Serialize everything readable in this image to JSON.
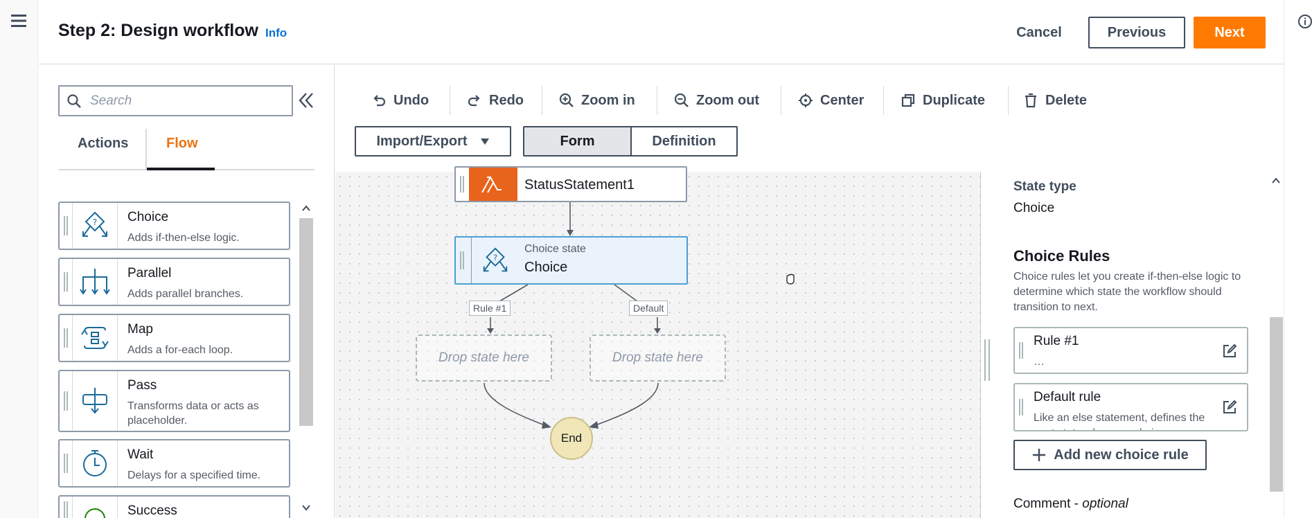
{
  "header": {
    "title": "Step 2: Design workflow",
    "info_link": "Info",
    "cancel_label": "Cancel",
    "previous_label": "Previous",
    "next_label": "Next"
  },
  "palette": {
    "search_placeholder": "Search",
    "tabs": [
      {
        "label": "Actions",
        "selected": false
      },
      {
        "label": "Flow",
        "selected": true
      }
    ],
    "items": [
      {
        "title": "Choice",
        "description": "Adds if-then-else logic.",
        "icon": "choice-icon"
      },
      {
        "title": "Parallel",
        "description": "Adds parallel branches.",
        "icon": "parallel-icon"
      },
      {
        "title": "Map",
        "description": "Adds a for-each loop.",
        "icon": "map-icon"
      },
      {
        "title": "Pass",
        "description": "Transforms data or acts as placeholder.",
        "icon": "pass-icon"
      },
      {
        "title": "Wait",
        "description": "Delays for a specified time.",
        "icon": "wait-icon"
      },
      {
        "title": "Success",
        "description": "",
        "icon": "success-icon"
      }
    ]
  },
  "toolbar": {
    "undo": "Undo",
    "redo": "Redo",
    "zoom_in": "Zoom in",
    "zoom_out": "Zoom out",
    "center": "Center",
    "duplicate": "Duplicate",
    "delete": "Delete",
    "import_export": "Import/Export",
    "form": "Form",
    "definition": "Definition"
  },
  "canvas": {
    "status_node_label": "StatusStatement1",
    "choice_node_subtitle": "Choice state",
    "choice_node_label": "Choice",
    "edge_rule_label": "Rule #1",
    "edge_default_label": "Default",
    "drop_placeholder": "Drop state here",
    "end_label": "End"
  },
  "inspector": {
    "state_type_label": "State type",
    "state_type_value": "Choice",
    "choice_rules_title": "Choice Rules",
    "choice_rules_help": "Choice rules let you create if-then-else logic to determine which state the workflow should transition to next.",
    "rules": [
      {
        "title": "Rule #1",
        "description": "…"
      },
      {
        "title": "Default rule",
        "description": "Like an else statement, defines the next state when no rule is"
      }
    ],
    "add_rule_label": "Add new choice rule",
    "comment_label": "Comment",
    "comment_optional": "optional"
  },
  "colors": {
    "accent_orange": "#ff7a00",
    "link_blue": "#0972d3",
    "selected_node_bg": "#eaf3fb",
    "lambda_orange": "#e8631b"
  }
}
